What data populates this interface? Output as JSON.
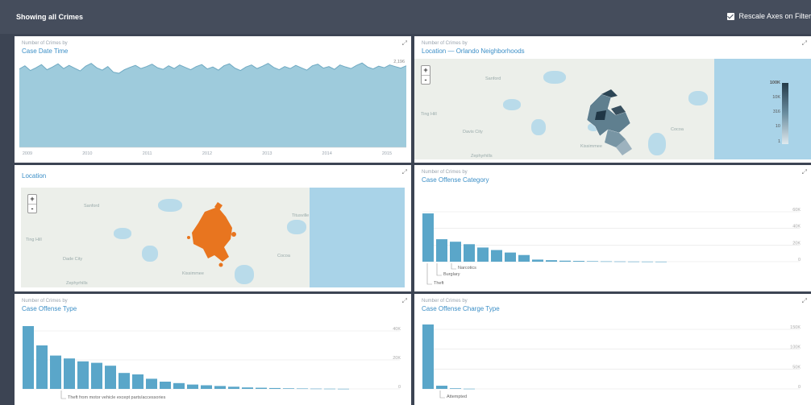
{
  "header": {
    "title": "Showing all Crimes",
    "rescale_label": "Rescale Axes on Filter",
    "rescale_checked": true
  },
  "panels": {
    "date": {
      "subtitle": "Number of Crimes by",
      "title": "Case Date Time"
    },
    "neighborhoods": {
      "subtitle": "Number of Crimes by",
      "title": "Location — Orlando Neighborhoods"
    },
    "location": {
      "title": "Location"
    },
    "category": {
      "subtitle": "Number of Crimes by",
      "title": "Case Offense Category"
    },
    "offense_type": {
      "subtitle": "Number of Crimes by",
      "title": "Case Offense Type"
    },
    "charge_type": {
      "subtitle": "Number of Crimes by",
      "title": "Case Offense Charge Type"
    }
  },
  "map_top": {
    "zoom_in": "+",
    "zoom_out": "-",
    "labels": [
      "Sanford",
      "Ting Hill",
      "Davis City",
      "Cocoa",
      "Kissimmee",
      "Zephyrhills"
    ],
    "legend_labels": [
      "100K",
      "10K",
      "316",
      "10",
      "1"
    ]
  },
  "map_bottom": {
    "zoom_in": "+",
    "zoom_out": "-",
    "labels": [
      "Sanford",
      "Titusville",
      "Ting Hill",
      "Dade City",
      "Cocoa",
      "Kissimmee",
      "Zephyrhills"
    ]
  },
  "chart_data": [
    {
      "type": "area",
      "name": "Case Date Time",
      "x_ticks": [
        "2009",
        "2010",
        "2011",
        "2012",
        "2013",
        "2014",
        "2015"
      ],
      "y_max_label": "2,196",
      "values": [
        1980,
        2060,
        1940,
        2010,
        2090,
        1960,
        2030,
        2110,
        1990,
        2070,
        2000,
        1930,
        2050,
        2120,
        2010,
        1950,
        2040,
        1900,
        1870,
        1960,
        2020,
        2070,
        1990,
        2040,
        2100,
        2010,
        1970,
        2060,
        1990,
        2080,
        2020,
        1960,
        2040,
        2090,
        1980,
        2030,
        1950,
        2060,
        2110,
        2000,
        1940,
        2030,
        2080,
        1990,
        2050,
        2120,
        2020,
        1960,
        2040,
        1990,
        2070,
        2010,
        1950,
        2060,
        2100,
        2000,
        2040,
        1970,
        2080,
        2030,
        1990,
        2070,
        2130,
        2030,
        1980,
        2050,
        2010,
        2080,
        2040,
        2000,
        2060
      ],
      "y_range": [
        0,
        2196
      ]
    },
    {
      "type": "bar",
      "name": "Case Offense Category",
      "values": [
        58000,
        27000,
        24000,
        21000,
        17000,
        14000,
        11000,
        8000,
        2500,
        1800,
        1200,
        900,
        600,
        400,
        300,
        200,
        150,
        100
      ],
      "y_ticks": [
        "60K",
        "40K",
        "20K",
        "0"
      ],
      "category_labels": [
        "Theft",
        "Burglary",
        "Narcotics"
      ],
      "y_range": [
        0,
        60000
      ]
    },
    {
      "type": "bar",
      "name": "Case Offense Type",
      "values": [
        48000,
        30000,
        23000,
        21000,
        19000,
        18000,
        16000,
        11000,
        10000,
        7000,
        5000,
        4000,
        3000,
        2500,
        2000,
        1500,
        1000,
        800,
        600,
        400,
        300,
        200,
        150,
        100
      ],
      "y_ticks": [
        "40K",
        "20K",
        "0"
      ],
      "category_labels": [
        "Theft from motor vehicle except parts/accessories"
      ],
      "y_range": [
        0,
        40000
      ]
    },
    {
      "type": "bar",
      "name": "Case Offense Charge Type",
      "values": [
        185000,
        8000,
        1500,
        500
      ],
      "y_ticks": [
        "150K",
        "100K",
        "50K",
        "0"
      ],
      "category_labels": [
        "Attempted"
      ],
      "y_range": [
        0,
        150000
      ]
    }
  ],
  "colors": {
    "background": "#3c4453",
    "topbar": "#454d5c",
    "accent": "#3c8fc7",
    "bar": "#5aa6c9",
    "area": "#9ecbdc",
    "area_line": "#6fa9c2",
    "orange": "#e8751f"
  }
}
